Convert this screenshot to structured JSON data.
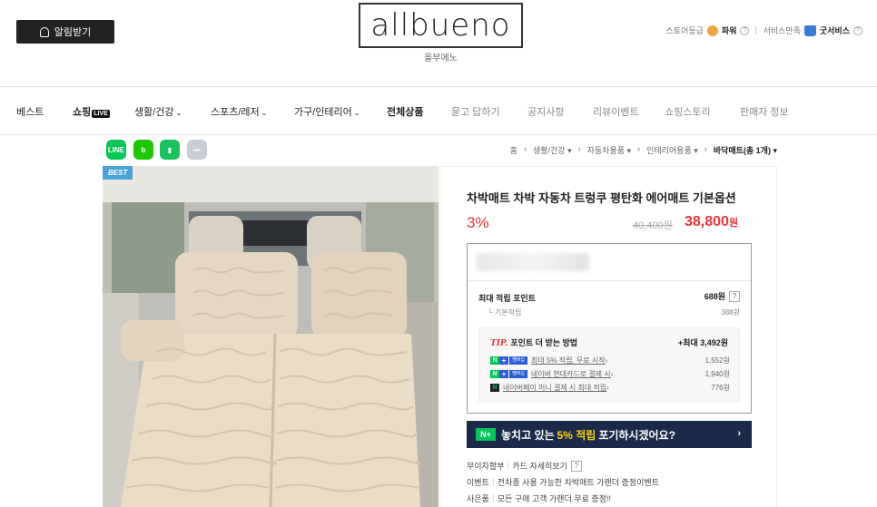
{
  "header": {
    "notify_label": "알림받기",
    "logo": "allbueno",
    "logo_sub": "올부에노",
    "store_grade_label": "스토어등급",
    "store_grade_value": "파워",
    "service_label": "서비스만족",
    "service_value": "굿서비스"
  },
  "nav": {
    "items": [
      "베스트",
      "쇼핑",
      "생활/건강",
      "스포츠/레저",
      "가구/인테리어",
      "전체상품",
      "묻고 답하기",
      "공지사항",
      "리뷰이벤트",
      "쇼핑스토리",
      "판매자 정보"
    ],
    "live_badge": "LIVE"
  },
  "breadcrumb": [
    "홈",
    "생활/건강",
    "자동차용품",
    "인테리어용품",
    "바닥매트(총 1개)"
  ],
  "product": {
    "badge": "BEST",
    "title": "차박매트 차박 자동차 트렁쿠 평탄화 에어매트 기본옵션",
    "discount": "3%",
    "original_price": "40,400원",
    "price": "38,800",
    "price_unit": "원"
  },
  "benefit": {
    "max_points_label": "최대 적립 포인트",
    "max_points_value": "688원",
    "basic_label": "기본적립",
    "basic_value": "388원",
    "tip_prefix": "TIP.",
    "tip_title": "포인트 더 받는 방법",
    "tip_max": "+최대 3,492원",
    "tip_rows": [
      {
        "text": "최대 5% 적립, 무료 시작",
        "amount": "1,552원"
      },
      {
        "text": "네이버 현대카드로 결제 시",
        "amount": "1,940원"
      },
      {
        "text": "네이버페이 머니 결제 시 최대 적립",
        "amount": "776원"
      }
    ],
    "membership_tag": "멤버십"
  },
  "banner": {
    "before": "놓치고 있는",
    "highlight": "5% 적립",
    "after": "포기하시겠어요?"
  },
  "info": {
    "installment_label": "무이자할부",
    "installment_link": "카드 자세히보기",
    "event_label": "이벤트",
    "event_text": "전차종 사용 가능한 차박매트 가랜더 증정이벤트",
    "gift_label": "사은품",
    "gift_text": "모든 구매 고객 가랜더 무료 증정!!"
  },
  "colors": {
    "sale_red": "#e8343c",
    "naver_green": "#03c75a",
    "banner_navy": "#1b2a4a",
    "best_blue": "#4aa3d8"
  }
}
